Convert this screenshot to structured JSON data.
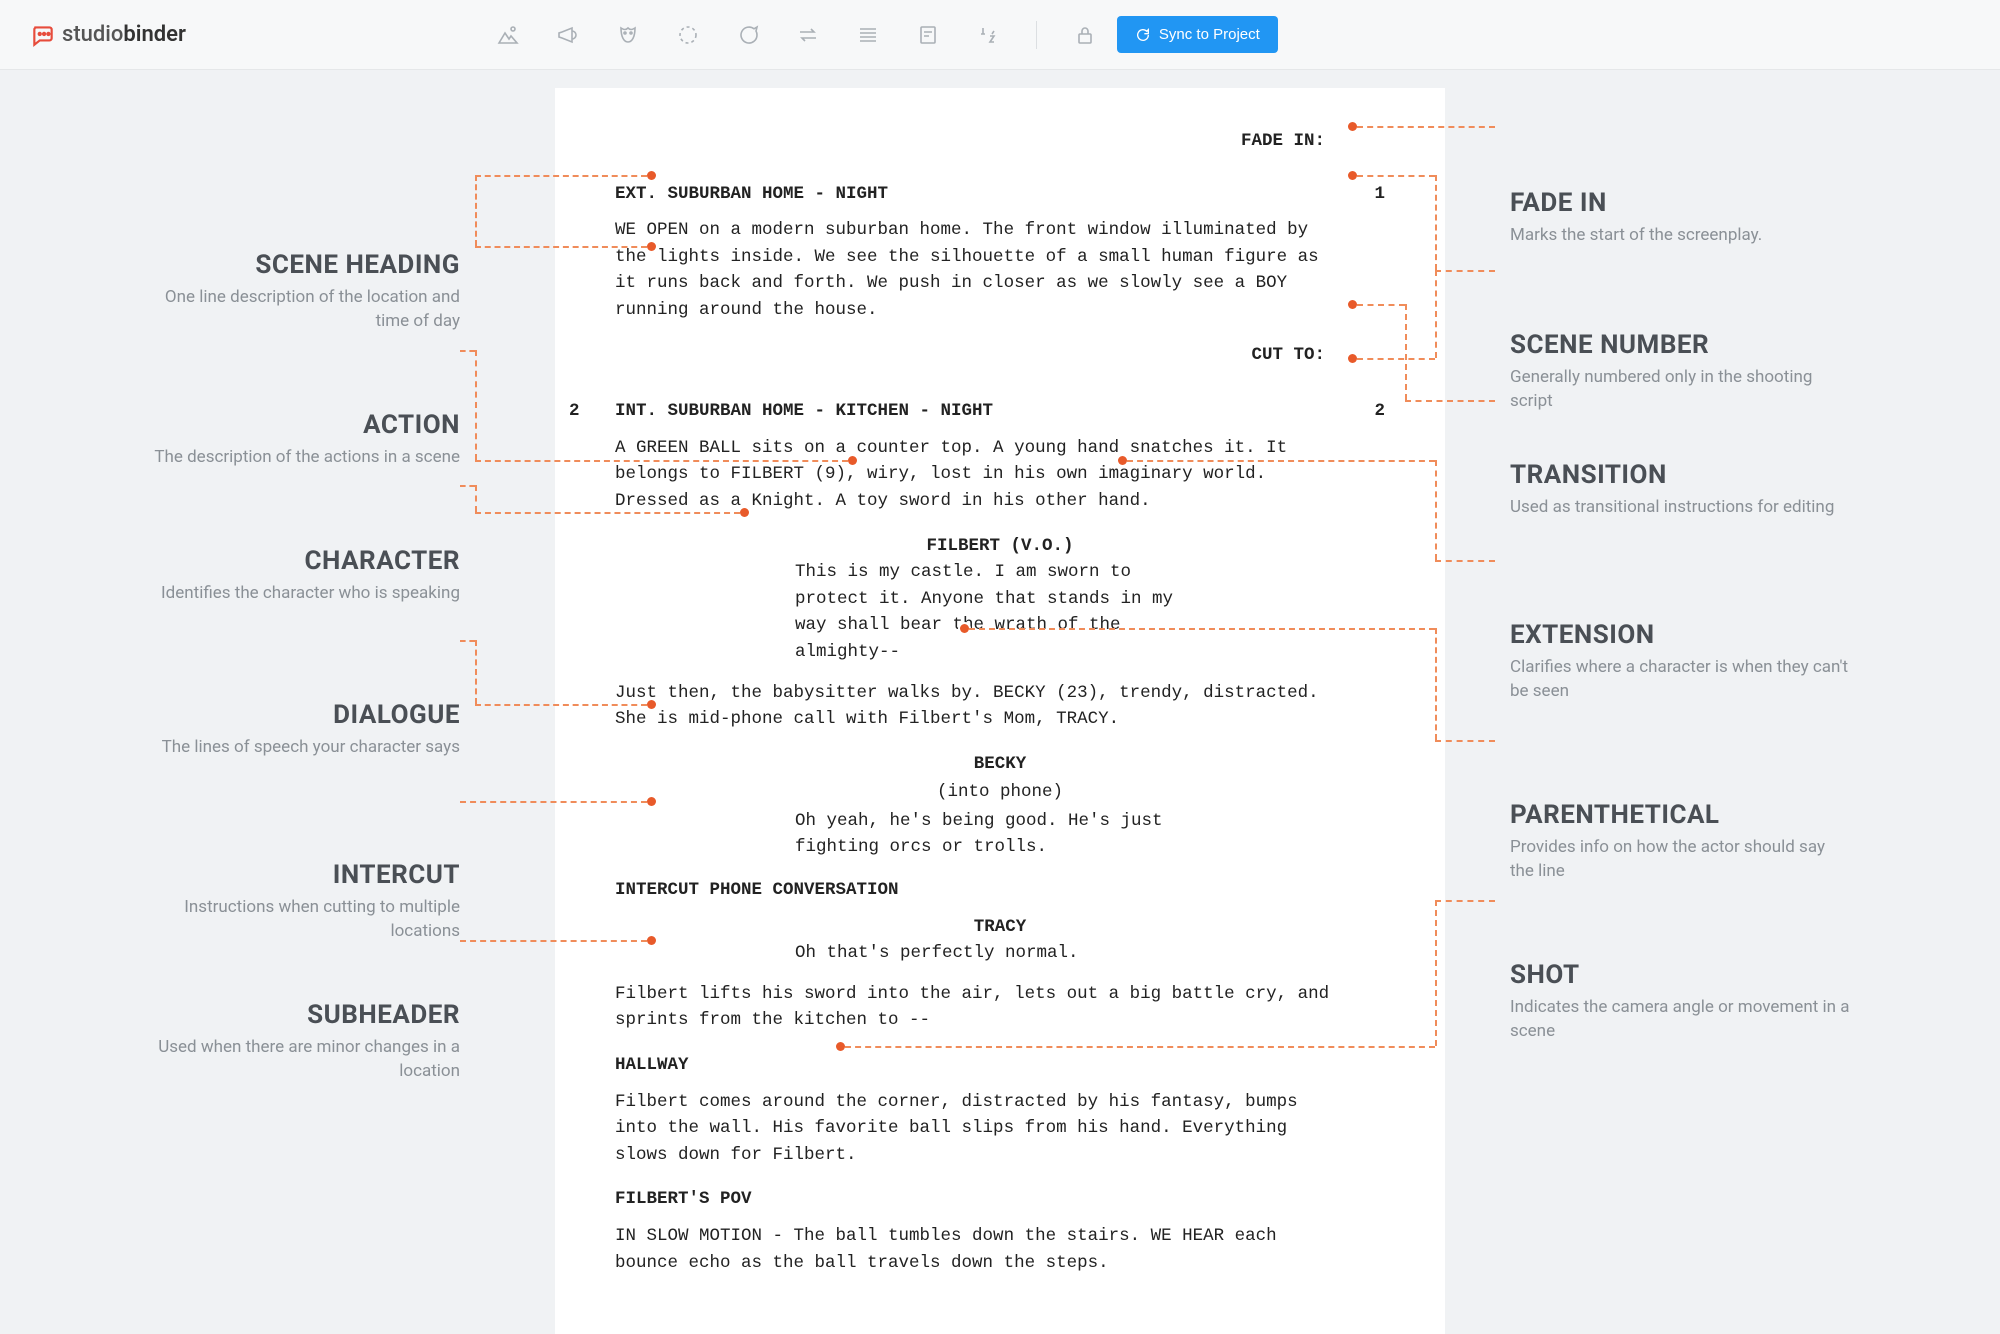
{
  "header": {
    "logo_prefix": "studio",
    "logo_suffix": "binder",
    "sync_label": "Sync to Project"
  },
  "script": {
    "fade_in": "FADE IN:",
    "scene1": {
      "heading": "EXT. SUBURBAN HOME - NIGHT",
      "number": "1",
      "action": "WE OPEN on a modern suburban home. The front window illuminated by the lights inside. We see the silhouette of a small human figure as it runs back and forth. We push in closer as we slowly see a BOY running around the house."
    },
    "transition1": "CUT TO:",
    "scene2": {
      "left_num": "2",
      "heading": "INT. SUBURBAN HOME - KITCHEN - NIGHT",
      "number": "2",
      "action1": "A GREEN BALL sits on a counter top. A young hand snatches it. It belongs to FILBERT (9), wiry, lost in his own imaginary world. Dressed as a Knight. A toy sword in his other hand.",
      "char1": "FILBERT (V.O.)",
      "dialog1": "This is my castle. I am sworn to protect it. Anyone that stands in my way shall bear the wrath of the almighty--",
      "action2": "Just then, the babysitter walks by. BECKY (23), trendy, distracted. She is mid-phone call with Filbert's Mom, TRACY.",
      "char2": "BECKY",
      "paren2": "(into phone)",
      "dialog2": "Oh yeah, he's being good. He's just fighting orcs or trolls.",
      "intercut": "INTERCUT PHONE CONVERSATION",
      "char3": "TRACY",
      "dialog3": "Oh that's perfectly normal.",
      "action3": "Filbert lifts his sword into the air, lets out a big battle cry, and sprints from the kitchen to --",
      "sub1": "HALLWAY",
      "action4": "Filbert comes around the corner, distracted by his fantasy, bumps into the wall. His favorite ball slips from his hand. Everything slows down for Filbert.",
      "sub2": "FILBERT'S POV",
      "action5": "IN SLOW MOTION - The ball tumbles down the stairs. WE HEAR each bounce echo as the ball travels down the steps."
    }
  },
  "annotations": {
    "left": [
      {
        "title": "SCENE HEADING",
        "desc": "One line description of the location and time of day"
      },
      {
        "title": "ACTION",
        "desc": "The description of the actions in a scene"
      },
      {
        "title": "CHARACTER",
        "desc": "Identifies the character who is speaking"
      },
      {
        "title": "DIALOGUE",
        "desc": "The lines of speech your character says"
      },
      {
        "title": "INTERCUT",
        "desc": "Instructions when cutting to multiple locations"
      },
      {
        "title": "SUBHEADER",
        "desc": "Used when there are minor changes in a location"
      }
    ],
    "right": [
      {
        "title": "FADE IN",
        "desc": "Marks the start of the screenplay."
      },
      {
        "title": "SCENE NUMBER",
        "desc": "Generally numbered only in the shooting script"
      },
      {
        "title": "TRANSITION",
        "desc": "Used as transitional instructions for editing"
      },
      {
        "title": "EXTENSION",
        "desc": "Clarifies where a character is when they can't be seen"
      },
      {
        "title": "PARENTHETICAL",
        "desc": "Provides info on how the actor should say the line"
      },
      {
        "title": "SHOT",
        "desc": "Indicates the camera angle or movement in a scene"
      }
    ]
  }
}
